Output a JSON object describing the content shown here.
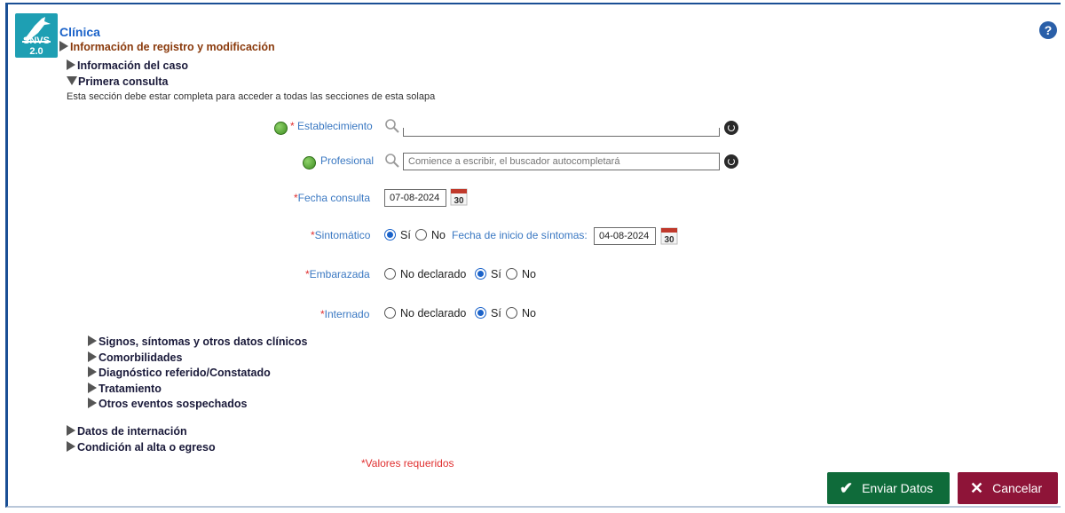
{
  "header": {
    "logo_text": "SNVS 2.0",
    "title": "Clínica",
    "help_symbol": "?"
  },
  "sections": {
    "registro": "Información de registro y modificación",
    "caso": "Información del caso",
    "primera_consulta": "Primera consulta",
    "note": "Esta sección debe estar completa para acceder a todas las secciones de esta solapa"
  },
  "form": {
    "establecimiento_label": "Establecimiento",
    "establecimiento_value": "",
    "profesional_label": "Profesional",
    "profesional_placeholder": "Comience a escribir, el buscador autocompletará",
    "fecha_consulta_label": "Fecha consulta",
    "fecha_consulta_value": "07-08-2024",
    "calendar_day": "30",
    "sintomatico_label": "Sintomático",
    "opt_si": "Sí",
    "opt_no": "No",
    "fecha_inicio_label": "Fecha de inicio de síntomas:",
    "fecha_inicio_value": "04-08-2024",
    "embarazada_label": "Embarazada",
    "opt_no_declarado": "No declarado",
    "internado_label": "Internado",
    "required_mark": "*"
  },
  "subsections": [
    "Signos, síntomas y otros datos clínicos",
    "Comorbilidades",
    "Diagnóstico referido/Constatado",
    "Tratamiento",
    "Otros eventos sospechados"
  ],
  "lower_sections": {
    "internacion": "Datos de internación",
    "condicion": "Condición al alta o egreso"
  },
  "footer": {
    "required_note": "*Valores requeridos",
    "send_label": "Enviar Datos",
    "cancel_label": "Cancelar"
  },
  "colors": {
    "accent_blue": "#1a62c9",
    "label_blue": "#3a78c2",
    "required_red": "#e03030",
    "send_green": "#0f6b3a",
    "cancel_red": "#8e1438",
    "frame_blue": "#1a4f95"
  }
}
